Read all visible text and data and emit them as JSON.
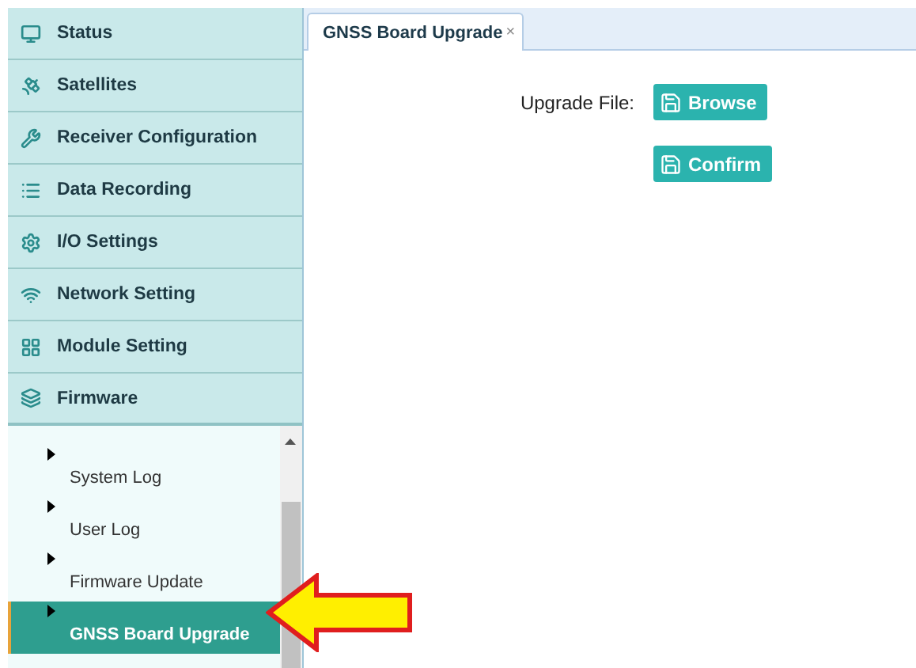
{
  "sidebar": {
    "items": [
      {
        "label": "Status",
        "expanded": false
      },
      {
        "label": "Satellites",
        "expanded": false
      },
      {
        "label": "Receiver Configuration",
        "expanded": false
      },
      {
        "label": "Data Recording",
        "expanded": false
      },
      {
        "label": "I/O Settings",
        "expanded": false
      },
      {
        "label": "Network Setting",
        "expanded": false
      },
      {
        "label": "Module Setting",
        "expanded": false
      },
      {
        "label": "Firmware",
        "expanded": true
      }
    ],
    "submenu": [
      {
        "label": "System Log",
        "selected": false
      },
      {
        "label": "User Log",
        "selected": false
      },
      {
        "label": "Firmware Update",
        "selected": false
      },
      {
        "label": "GNSS Board Upgrade",
        "selected": true
      }
    ]
  },
  "tabs": [
    {
      "label": "GNSS Board Upgrade",
      "close": "×",
      "selected": true
    }
  ],
  "form": {
    "label": "Upgrade File:",
    "buttons": [
      "Browse",
      "Confirm"
    ]
  }
}
